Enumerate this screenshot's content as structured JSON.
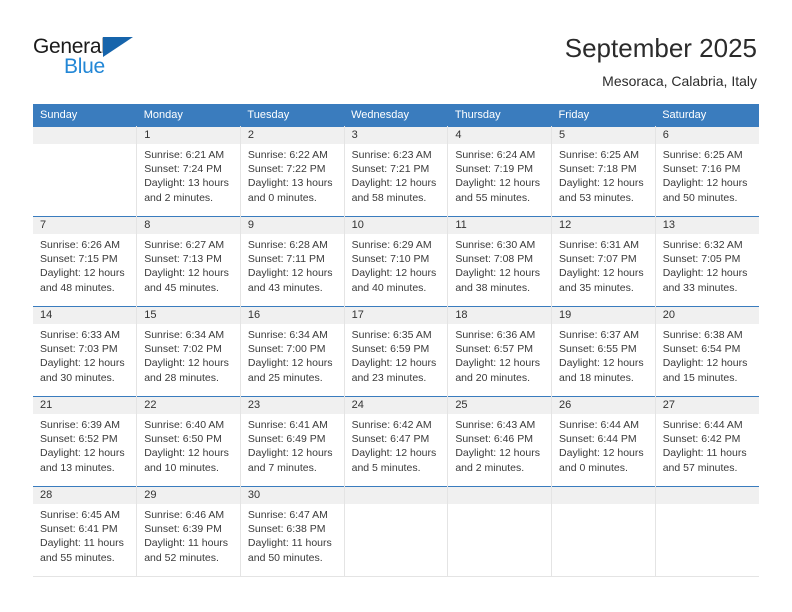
{
  "logo": {
    "text_top": "General",
    "text_bottom": "Blue",
    "triangle_color": "#1664ab",
    "bottom_color": "#2387d6"
  },
  "header": {
    "title": "September 2025",
    "subtitle": "Mesoraca, Calabria, Italy"
  },
  "theme": {
    "header_blue": "#3a7cbe",
    "daynum_strip": "#f0f0f0",
    "cell_border": "#e4e4e4",
    "text": "#3a3a3a"
  },
  "weekdays": [
    "Sunday",
    "Monday",
    "Tuesday",
    "Wednesday",
    "Thursday",
    "Friday",
    "Saturday"
  ],
  "weeks": [
    [
      {
        "day": "",
        "empty": true,
        "sunrise": "",
        "sunset": "",
        "daylight_1": "",
        "daylight_2": ""
      },
      {
        "day": "1",
        "sunrise": "Sunrise: 6:21 AM",
        "sunset": "Sunset: 7:24 PM",
        "daylight_1": "Daylight: 13 hours",
        "daylight_2": "and 2 minutes."
      },
      {
        "day": "2",
        "sunrise": "Sunrise: 6:22 AM",
        "sunset": "Sunset: 7:22 PM",
        "daylight_1": "Daylight: 13 hours",
        "daylight_2": "and 0 minutes."
      },
      {
        "day": "3",
        "sunrise": "Sunrise: 6:23 AM",
        "sunset": "Sunset: 7:21 PM",
        "daylight_1": "Daylight: 12 hours",
        "daylight_2": "and 58 minutes."
      },
      {
        "day": "4",
        "sunrise": "Sunrise: 6:24 AM",
        "sunset": "Sunset: 7:19 PM",
        "daylight_1": "Daylight: 12 hours",
        "daylight_2": "and 55 minutes."
      },
      {
        "day": "5",
        "sunrise": "Sunrise: 6:25 AM",
        "sunset": "Sunset: 7:18 PM",
        "daylight_1": "Daylight: 12 hours",
        "daylight_2": "and 53 minutes."
      },
      {
        "day": "6",
        "sunrise": "Sunrise: 6:25 AM",
        "sunset": "Sunset: 7:16 PM",
        "daylight_1": "Daylight: 12 hours",
        "daylight_2": "and 50 minutes."
      }
    ],
    [
      {
        "day": "7",
        "sunrise": "Sunrise: 6:26 AM",
        "sunset": "Sunset: 7:15 PM",
        "daylight_1": "Daylight: 12 hours",
        "daylight_2": "and 48 minutes."
      },
      {
        "day": "8",
        "sunrise": "Sunrise: 6:27 AM",
        "sunset": "Sunset: 7:13 PM",
        "daylight_1": "Daylight: 12 hours",
        "daylight_2": "and 45 minutes."
      },
      {
        "day": "9",
        "sunrise": "Sunrise: 6:28 AM",
        "sunset": "Sunset: 7:11 PM",
        "daylight_1": "Daylight: 12 hours",
        "daylight_2": "and 43 minutes."
      },
      {
        "day": "10",
        "sunrise": "Sunrise: 6:29 AM",
        "sunset": "Sunset: 7:10 PM",
        "daylight_1": "Daylight: 12 hours",
        "daylight_2": "and 40 minutes."
      },
      {
        "day": "11",
        "sunrise": "Sunrise: 6:30 AM",
        "sunset": "Sunset: 7:08 PM",
        "daylight_1": "Daylight: 12 hours",
        "daylight_2": "and 38 minutes."
      },
      {
        "day": "12",
        "sunrise": "Sunrise: 6:31 AM",
        "sunset": "Sunset: 7:07 PM",
        "daylight_1": "Daylight: 12 hours",
        "daylight_2": "and 35 minutes."
      },
      {
        "day": "13",
        "sunrise": "Sunrise: 6:32 AM",
        "sunset": "Sunset: 7:05 PM",
        "daylight_1": "Daylight: 12 hours",
        "daylight_2": "and 33 minutes."
      }
    ],
    [
      {
        "day": "14",
        "sunrise": "Sunrise: 6:33 AM",
        "sunset": "Sunset: 7:03 PM",
        "daylight_1": "Daylight: 12 hours",
        "daylight_2": "and 30 minutes."
      },
      {
        "day": "15",
        "sunrise": "Sunrise: 6:34 AM",
        "sunset": "Sunset: 7:02 PM",
        "daylight_1": "Daylight: 12 hours",
        "daylight_2": "and 28 minutes."
      },
      {
        "day": "16",
        "sunrise": "Sunrise: 6:34 AM",
        "sunset": "Sunset: 7:00 PM",
        "daylight_1": "Daylight: 12 hours",
        "daylight_2": "and 25 minutes."
      },
      {
        "day": "17",
        "sunrise": "Sunrise: 6:35 AM",
        "sunset": "Sunset: 6:59 PM",
        "daylight_1": "Daylight: 12 hours",
        "daylight_2": "and 23 minutes."
      },
      {
        "day": "18",
        "sunrise": "Sunrise: 6:36 AM",
        "sunset": "Sunset: 6:57 PM",
        "daylight_1": "Daylight: 12 hours",
        "daylight_2": "and 20 minutes."
      },
      {
        "day": "19",
        "sunrise": "Sunrise: 6:37 AM",
        "sunset": "Sunset: 6:55 PM",
        "daylight_1": "Daylight: 12 hours",
        "daylight_2": "and 18 minutes."
      },
      {
        "day": "20",
        "sunrise": "Sunrise: 6:38 AM",
        "sunset": "Sunset: 6:54 PM",
        "daylight_1": "Daylight: 12 hours",
        "daylight_2": "and 15 minutes."
      }
    ],
    [
      {
        "day": "21",
        "sunrise": "Sunrise: 6:39 AM",
        "sunset": "Sunset: 6:52 PM",
        "daylight_1": "Daylight: 12 hours",
        "daylight_2": "and 13 minutes."
      },
      {
        "day": "22",
        "sunrise": "Sunrise: 6:40 AM",
        "sunset": "Sunset: 6:50 PM",
        "daylight_1": "Daylight: 12 hours",
        "daylight_2": "and 10 minutes."
      },
      {
        "day": "23",
        "sunrise": "Sunrise: 6:41 AM",
        "sunset": "Sunset: 6:49 PM",
        "daylight_1": "Daylight: 12 hours",
        "daylight_2": "and 7 minutes."
      },
      {
        "day": "24",
        "sunrise": "Sunrise: 6:42 AM",
        "sunset": "Sunset: 6:47 PM",
        "daylight_1": "Daylight: 12 hours",
        "daylight_2": "and 5 minutes."
      },
      {
        "day": "25",
        "sunrise": "Sunrise: 6:43 AM",
        "sunset": "Sunset: 6:46 PM",
        "daylight_1": "Daylight: 12 hours",
        "daylight_2": "and 2 minutes."
      },
      {
        "day": "26",
        "sunrise": "Sunrise: 6:44 AM",
        "sunset": "Sunset: 6:44 PM",
        "daylight_1": "Daylight: 12 hours",
        "daylight_2": "and 0 minutes."
      },
      {
        "day": "27",
        "sunrise": "Sunrise: 6:44 AM",
        "sunset": "Sunset: 6:42 PM",
        "daylight_1": "Daylight: 11 hours",
        "daylight_2": "and 57 minutes."
      }
    ],
    [
      {
        "day": "28",
        "sunrise": "Sunrise: 6:45 AM",
        "sunset": "Sunset: 6:41 PM",
        "daylight_1": "Daylight: 11 hours",
        "daylight_2": "and 55 minutes."
      },
      {
        "day": "29",
        "sunrise": "Sunrise: 6:46 AM",
        "sunset": "Sunset: 6:39 PM",
        "daylight_1": "Daylight: 11 hours",
        "daylight_2": "and 52 minutes."
      },
      {
        "day": "30",
        "sunrise": "Sunrise: 6:47 AM",
        "sunset": "Sunset: 6:38 PM",
        "daylight_1": "Daylight: 11 hours",
        "daylight_2": "and 50 minutes."
      },
      {
        "day": "",
        "empty": true,
        "sunrise": "",
        "sunset": "",
        "daylight_1": "",
        "daylight_2": ""
      },
      {
        "day": "",
        "empty": true,
        "sunrise": "",
        "sunset": "",
        "daylight_1": "",
        "daylight_2": ""
      },
      {
        "day": "",
        "empty": true,
        "sunrise": "",
        "sunset": "",
        "daylight_1": "",
        "daylight_2": ""
      },
      {
        "day": "",
        "empty": true,
        "sunrise": "",
        "sunset": "",
        "daylight_1": "",
        "daylight_2": ""
      }
    ]
  ]
}
